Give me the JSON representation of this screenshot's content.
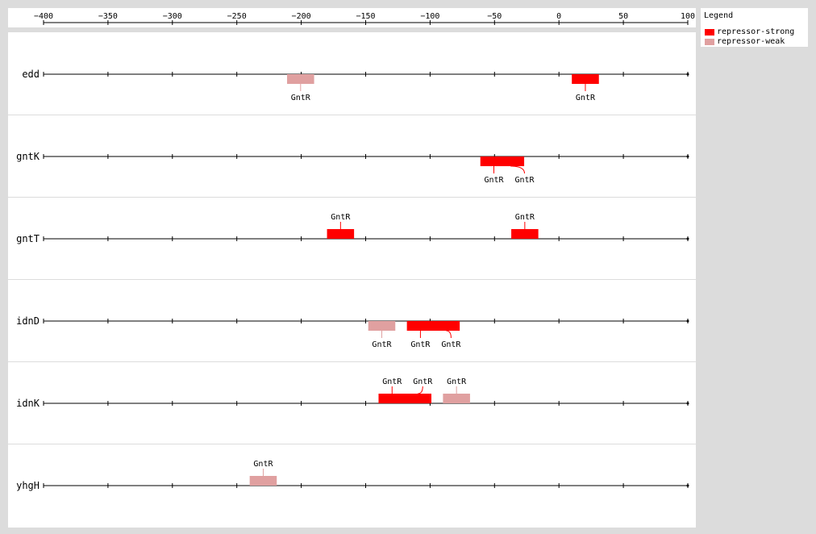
{
  "colors": {
    "repressor-strong": "#ff0000",
    "repressor-weak": "#e0a0a0",
    "line": "#000000",
    "row_separator": "#dcdcdc"
  },
  "legend": {
    "title": "Legend",
    "items": [
      {
        "key": "repressor-strong",
        "label": "repressor-strong"
      },
      {
        "key": "repressor-weak",
        "label": "repressor-weak"
      }
    ]
  },
  "axis": {
    "min": -400,
    "max": 100,
    "ticks": [
      -400,
      -350,
      -300,
      -250,
      -200,
      -150,
      -100,
      -50,
      0,
      50,
      100
    ],
    "tick_labels": [
      "−400",
      "−350",
      "−300",
      "−250",
      "−200",
      "−150",
      "−100",
      "−50",
      "0",
      "50",
      "100"
    ]
  },
  "rows": [
    {
      "gene": "edd",
      "sites": [
        {
          "label": "GntR",
          "start": -211,
          "end": -190,
          "type": "repressor-weak",
          "label_side": "below"
        },
        {
          "label": "GntR",
          "start": 10,
          "end": 31,
          "type": "repressor-strong",
          "label_side": "below"
        }
      ]
    },
    {
      "gene": "gntK",
      "sites": [
        {
          "label": "GntR",
          "start": -61,
          "end": -40,
          "type": "repressor-strong",
          "label_side": "below"
        },
        {
          "label": "GntR",
          "start": -48,
          "end": -27,
          "type": "repressor-strong",
          "label_side": "below"
        }
      ]
    },
    {
      "gene": "gntT",
      "sites": [
        {
          "label": "GntR",
          "start": -180,
          "end": -159,
          "type": "repressor-strong",
          "label_side": "above"
        },
        {
          "label": "GntR",
          "start": -37,
          "end": -16,
          "type": "repressor-strong",
          "label_side": "above"
        }
      ]
    },
    {
      "gene": "idnD",
      "sites": [
        {
          "label": "GntR",
          "start": -148,
          "end": -127,
          "type": "repressor-weak",
          "label_side": "below"
        },
        {
          "label": "GntR",
          "start": -118,
          "end": -97,
          "type": "repressor-strong",
          "label_side": "below"
        },
        {
          "label": "GntR",
          "start": -98,
          "end": -77,
          "type": "repressor-strong",
          "label_side": "below"
        }
      ]
    },
    {
      "gene": "idnK",
      "sites": [
        {
          "label": "GntR",
          "start": -140,
          "end": -119,
          "type": "repressor-strong",
          "label_side": "above"
        },
        {
          "label": "GntR",
          "start": -120,
          "end": -99,
          "type": "repressor-strong",
          "label_side": "above"
        },
        {
          "label": "GntR",
          "start": -90,
          "end": -69,
          "type": "repressor-weak",
          "label_side": "above"
        }
      ]
    },
    {
      "gene": "yhgH",
      "sites": [
        {
          "label": "GntR",
          "start": -240,
          "end": -219,
          "type": "repressor-weak",
          "label_side": "above"
        }
      ]
    }
  ]
}
